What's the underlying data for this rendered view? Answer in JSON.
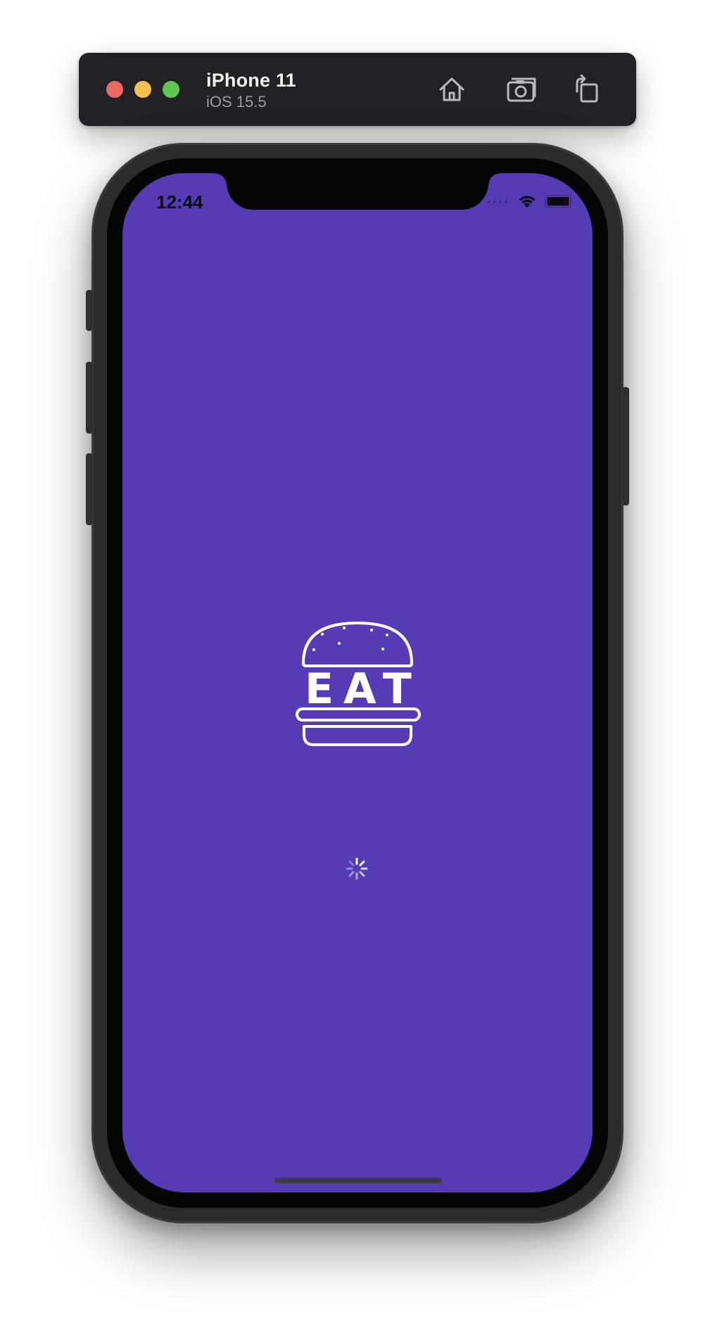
{
  "simulator": {
    "device_name": "iPhone 11",
    "os_version": "iOS 15.5",
    "icons": [
      "home-icon",
      "screenshot-icon",
      "rotate-icon"
    ]
  },
  "status_bar": {
    "time": "12:44",
    "icons": [
      "signal-icon",
      "wifi-icon",
      "battery-icon"
    ]
  },
  "splash": {
    "logo_text": "EAT",
    "background_color": "#573bb5",
    "loading_indicator": "activity-spinner-icon"
  }
}
